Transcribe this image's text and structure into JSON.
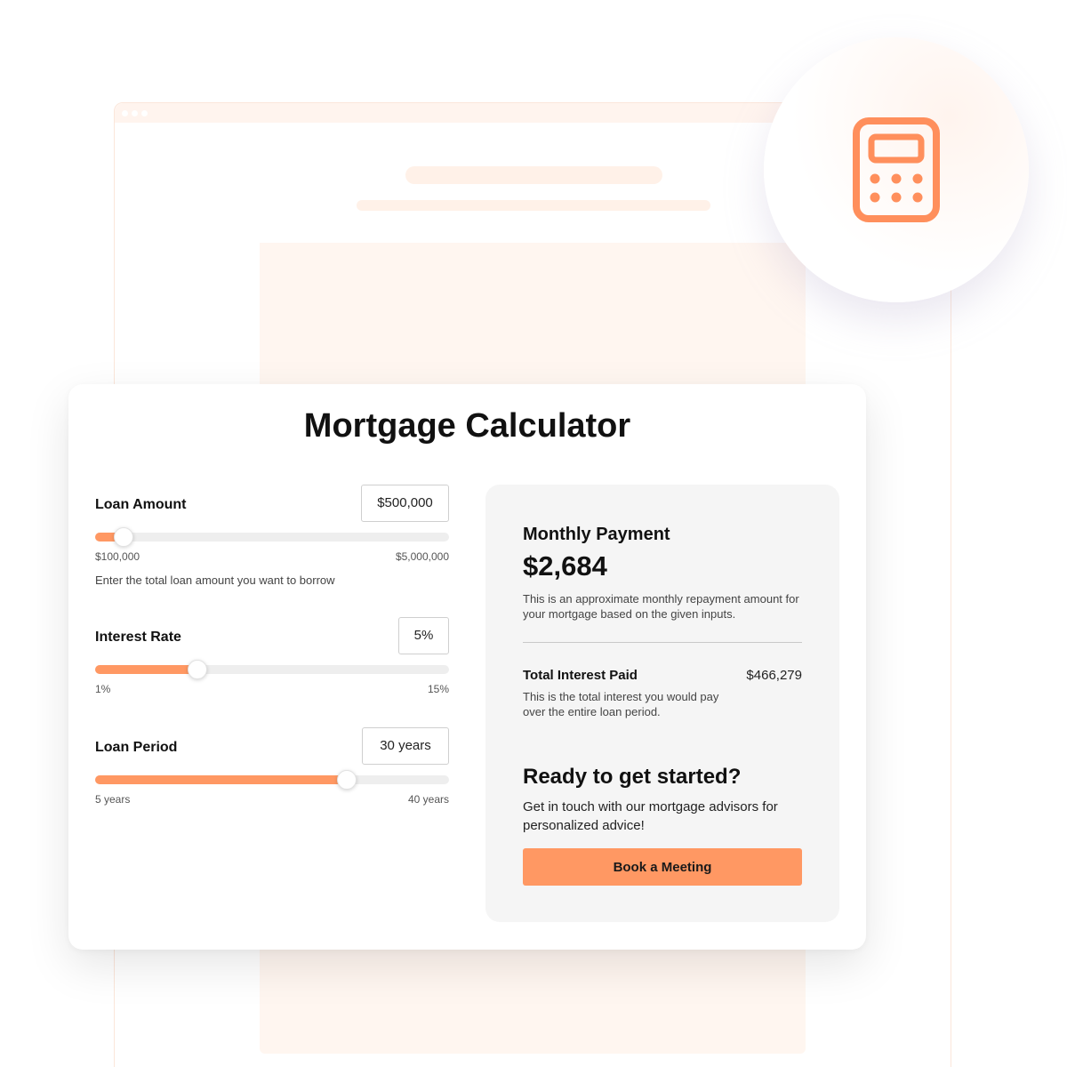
{
  "title": "Mortgage Calculator",
  "colors": {
    "accent": "#ff9863",
    "panel_bg": "#f5f5f5",
    "track": "#eeeeee",
    "icon_stroke": "#ff8f5c"
  },
  "hero_icon": "calculator-icon",
  "loan_amount": {
    "label": "Loan Amount",
    "value": "$500,000",
    "min_label": "$100,000",
    "max_label": "$5,000,000",
    "helper": "Enter the total loan amount you want to borrow",
    "slider_fraction": 0.08
  },
  "interest_rate": {
    "label": "Interest Rate",
    "value": "5%",
    "min_label": "1%",
    "max_label": "15%",
    "slider_fraction": 0.29
  },
  "loan_period": {
    "label": "Loan Period",
    "value": "30 years",
    "min_label": "5 years",
    "max_label": "40 years",
    "slider_fraction": 0.71
  },
  "results": {
    "monthly_label": "Monthly Payment",
    "monthly_value": "$2,684",
    "monthly_desc": "This is an approximate monthly repayment amount for your mortgage based on the given inputs.",
    "interest_label": "Total Interest Paid",
    "interest_value": "$466,279",
    "interest_desc": "This is the total interest you would pay over the entire loan period."
  },
  "cta": {
    "title": "Ready to get started?",
    "desc": "Get in touch with our mortgage advisors for personalized advice!",
    "button": "Book a Meeting"
  }
}
